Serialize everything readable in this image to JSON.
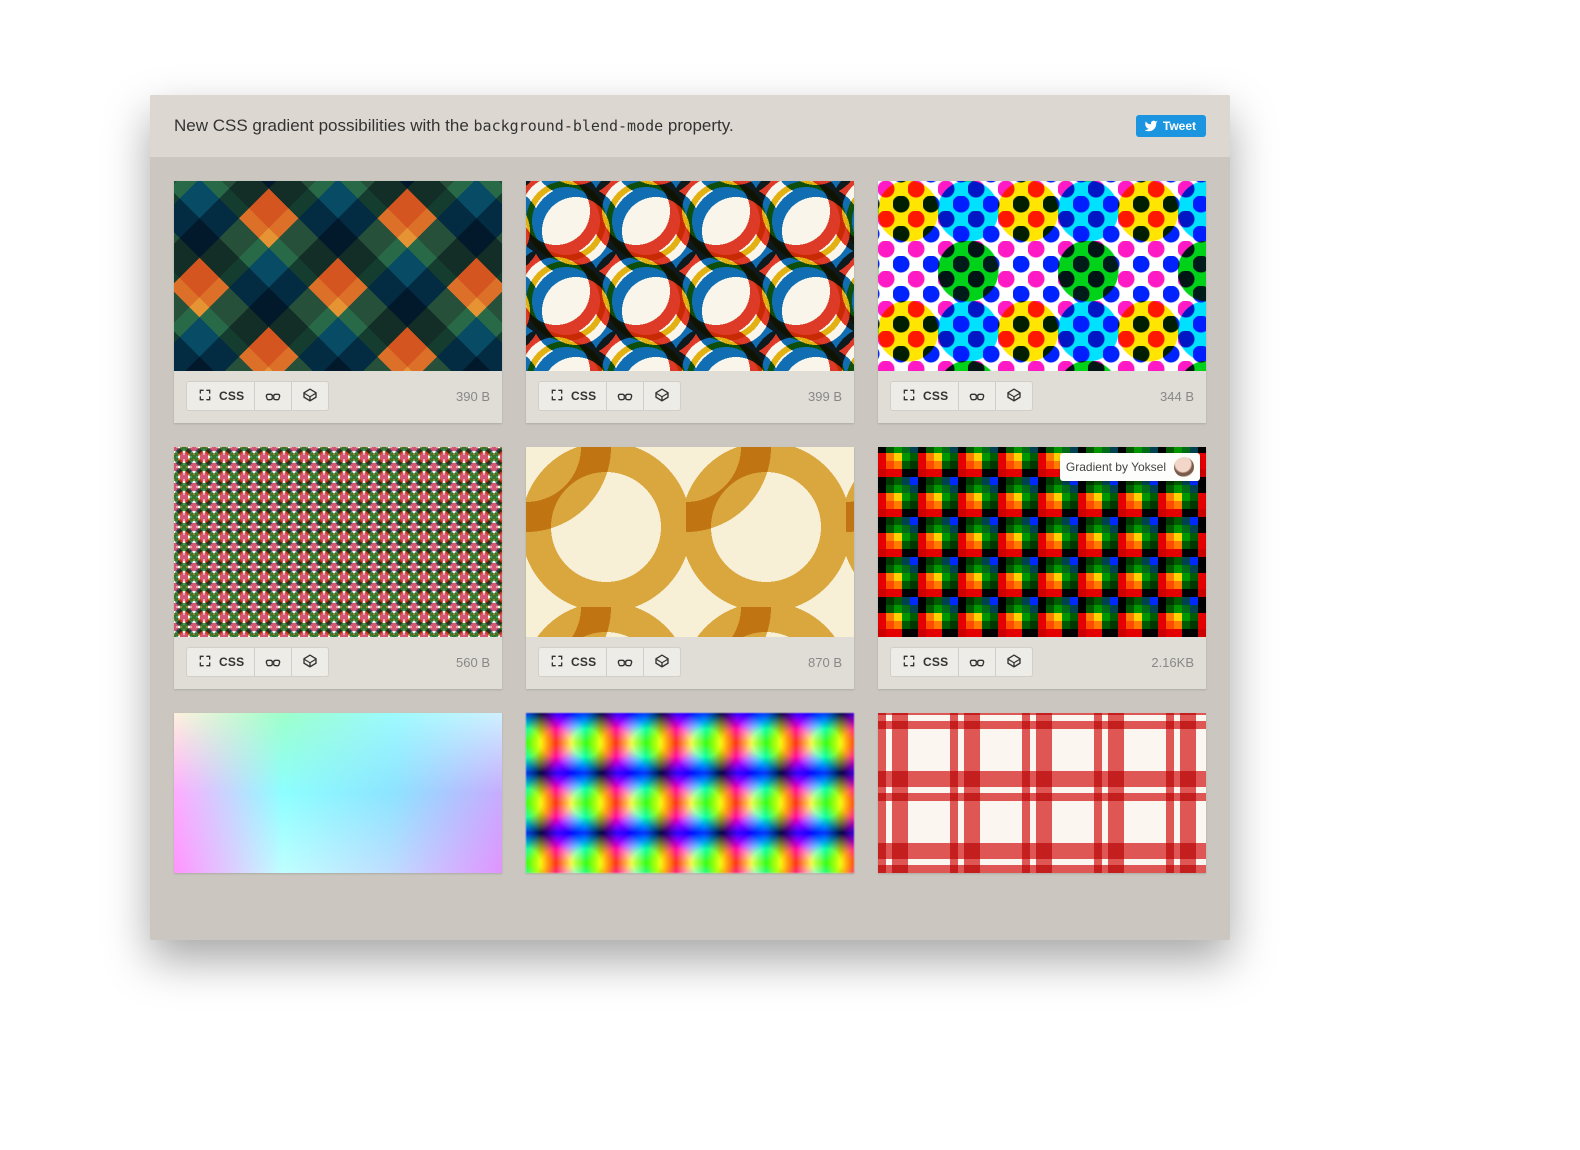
{
  "header": {
    "title_pre": "New CSS gradient possibilities with the ",
    "title_code": "background-blend-mode",
    "title_post": " property.",
    "tweet_label": "Tweet"
  },
  "actions": {
    "css_label": "CSS"
  },
  "cards": [
    {
      "size": "390 B",
      "pattern": "p1",
      "credit": null
    },
    {
      "size": "399 B",
      "pattern": "p2",
      "credit": null
    },
    {
      "size": "344 B",
      "pattern": "p3",
      "credit": null
    },
    {
      "size": "560 B",
      "pattern": "p4",
      "credit": null
    },
    {
      "size": "870 B",
      "pattern": "p5",
      "credit": null
    },
    {
      "size": "2.16KB",
      "pattern": "p6",
      "credit": "Gradient by Yoksel"
    },
    {
      "size": "",
      "pattern": "p7",
      "credit": null
    },
    {
      "size": "",
      "pattern": "p8",
      "credit": null
    },
    {
      "size": "",
      "pattern": "p9",
      "credit": null
    }
  ]
}
